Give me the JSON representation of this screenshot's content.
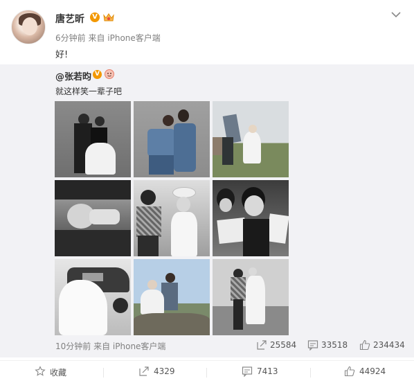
{
  "post": {
    "author": "唐艺昕",
    "verified_badge": "V",
    "time": "6分钟前",
    "source": "来自 iPhone客户端",
    "text": "好!"
  },
  "repost": {
    "author": "@张若昀",
    "verified_badge": "V",
    "text": "就这样笑一辈子吧",
    "time": "10分钟前",
    "source": "来自 iPhone客户端",
    "stats": {
      "reposts": "25584",
      "comments": "33518",
      "likes": "234434"
    }
  },
  "actions": {
    "favorite_label": "收藏",
    "repost_count": "4329",
    "comment_count": "7413",
    "like_count": "44924"
  },
  "colors": {
    "badge": "#f39800",
    "repost_bg": "#f2f2f5",
    "meta_text": "#808080"
  }
}
